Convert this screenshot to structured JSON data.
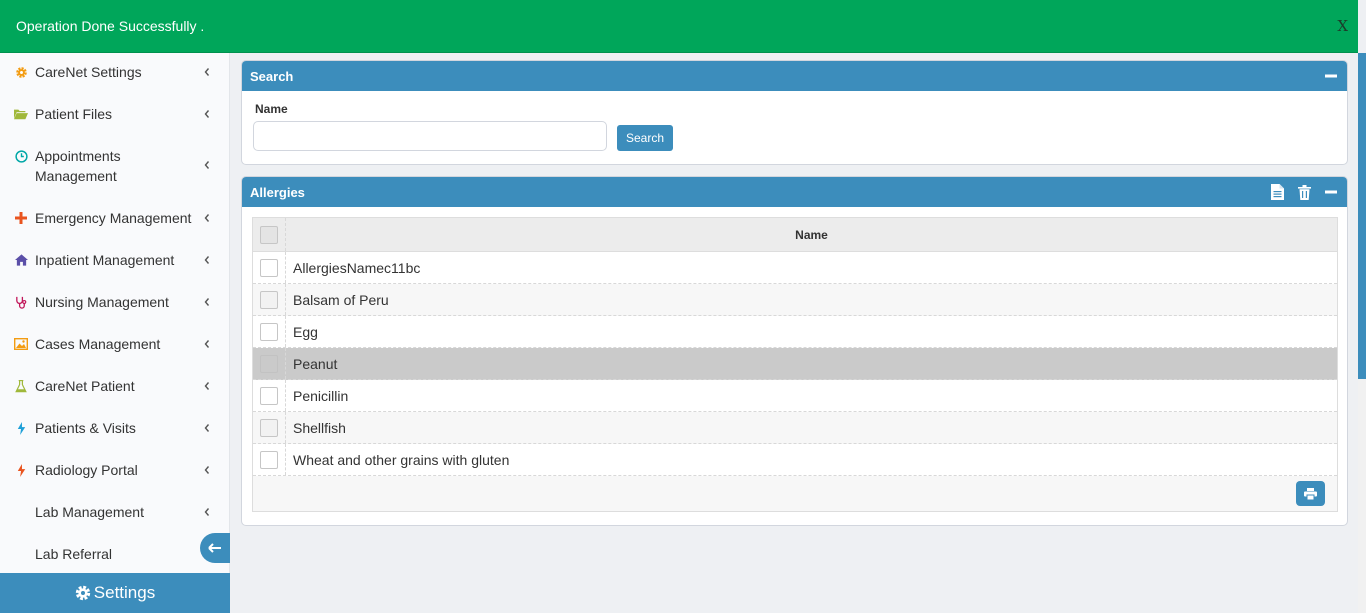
{
  "toast": {
    "message": "Operation Done Successfully .",
    "close_label": "X"
  },
  "sidebar": {
    "items": [
      {
        "label": "CareNet Settings",
        "icon": "gear-icon",
        "color": "#f39c12"
      },
      {
        "label": "Patient Files",
        "icon": "folder-open-icon",
        "color": "#a0b83a"
      },
      {
        "label": "Appointments Management",
        "icon": "clock-icon",
        "color": "#00a7a7"
      },
      {
        "label": "Emergency Management",
        "icon": "plus-icon",
        "color": "#e9541f"
      },
      {
        "label": "Inpatient Management",
        "icon": "home-icon",
        "color": "#5b4fa8"
      },
      {
        "label": "Nursing Management",
        "icon": "stethoscope-icon",
        "color": "#c2185b"
      },
      {
        "label": "Cases Management",
        "icon": "image-icon",
        "color": "#f39c12"
      },
      {
        "label": "CareNet Patient",
        "icon": "flask-icon",
        "color": "#a0b83a"
      },
      {
        "label": "Patients & Visits",
        "icon": "bolt-icon",
        "color": "#1fa0d8"
      },
      {
        "label": "Radiology Portal",
        "icon": "bolt-icon",
        "color": "#e9541f"
      },
      {
        "label": "Lab Management",
        "icon": "",
        "color": ""
      },
      {
        "label": "Lab Referral",
        "icon": "",
        "color": ""
      }
    ],
    "settings_label": "Settings"
  },
  "search_panel": {
    "title": "Search",
    "name_label": "Name",
    "name_value": "",
    "search_button": "Search"
  },
  "allergies_panel": {
    "title": "Allergies",
    "column_name": "Name",
    "rows": [
      "AllergiesNamec11bc",
      "Balsam of Peru",
      "Egg",
      "Peanut",
      "Penicillin",
      "Shellfish",
      "Wheat and other grains with gluten"
    ],
    "selected_row": "Peanut"
  },
  "colors": {
    "primary": "#3c8dbc",
    "success": "#00a65a"
  }
}
